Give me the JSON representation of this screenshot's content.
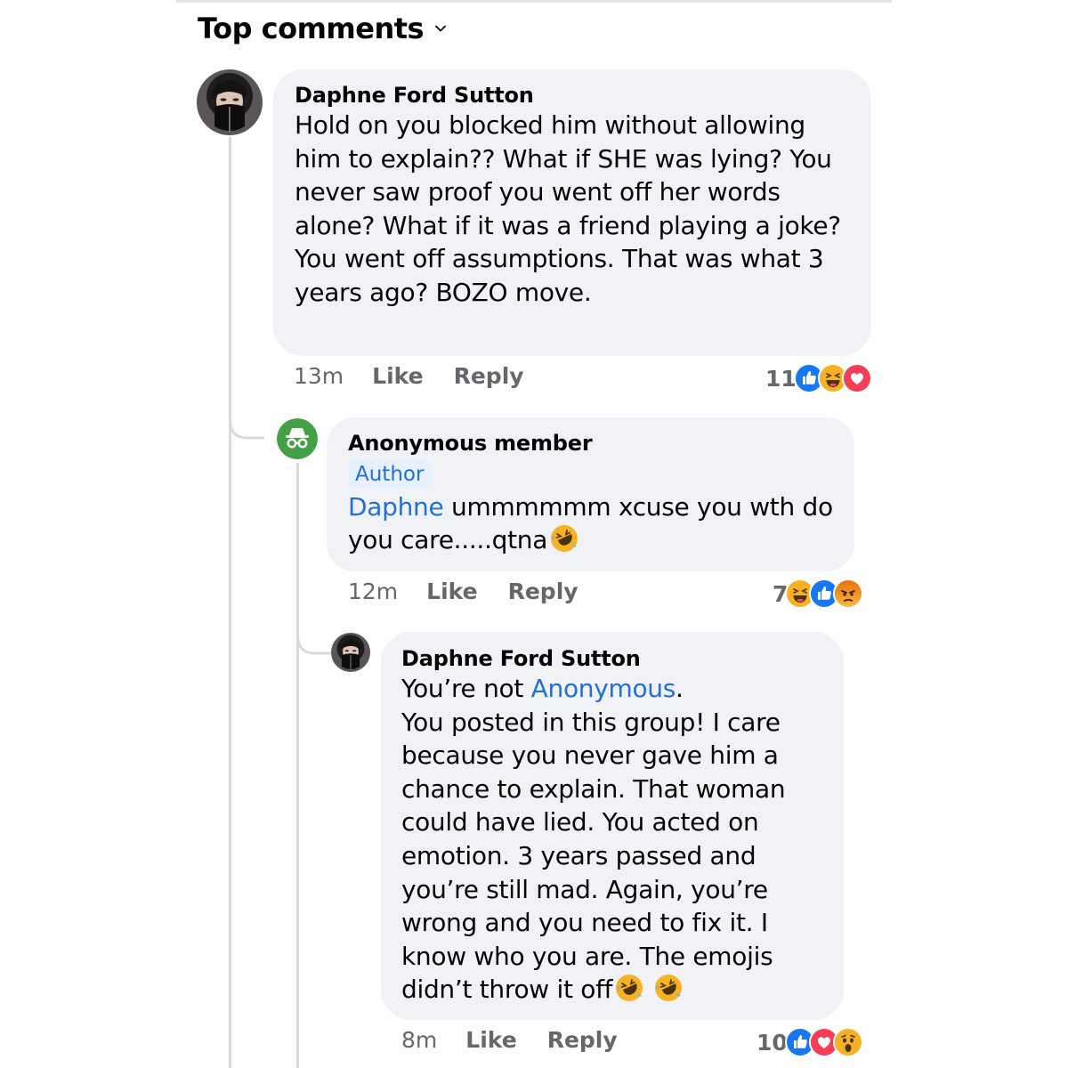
{
  "header": {
    "title": "Top comments"
  },
  "comments": [
    {
      "author": "Daphne Ford Sutton",
      "text": "Hold on you blocked him without allowing him to explain?? What if SHE was lying? You never saw proof you went off her words alone? What if it was a friend playing a joke? You went off assumptions. That was what 3 years ago? BOZO move.",
      "time": "13m",
      "like_label": "Like",
      "reply_label": "Reply",
      "reaction_count": "11",
      "reactions": [
        "like",
        "haha",
        "love"
      ]
    },
    {
      "author": "Anonymous member",
      "badge": "Author",
      "mention": "Daphne",
      "text": " ummmmmm xcuse you wth do you care.....qtna",
      "time": "12m",
      "like_label": "Like",
      "reply_label": "Reply",
      "reaction_count": "7",
      "reactions": [
        "haha",
        "like",
        "angry"
      ]
    },
    {
      "author": "Daphne Ford Sutton",
      "text_before_mention": "You’re not ",
      "mention": "Anonymous",
      "text_after_mention": ".",
      "text": "You posted in this group! I care because you never gave him a chance to explain. That woman could have lied. You acted on emotion. 3 years passed and you’re still mad. Again, you’re wrong and you need to fix it. I know who you are. The emojis didn’t throw it off",
      "time": "8m",
      "like_label": "Like",
      "reply_label": "Reply",
      "reaction_count": "10",
      "reactions": [
        "like",
        "love",
        "wow"
      ]
    }
  ],
  "colors": {
    "bubble": "#f0f2f5",
    "mention": "#216fdb",
    "meta": "#65676b",
    "like": "#1877f2",
    "love": "#f33e58",
    "haha": "#f7b125"
  }
}
